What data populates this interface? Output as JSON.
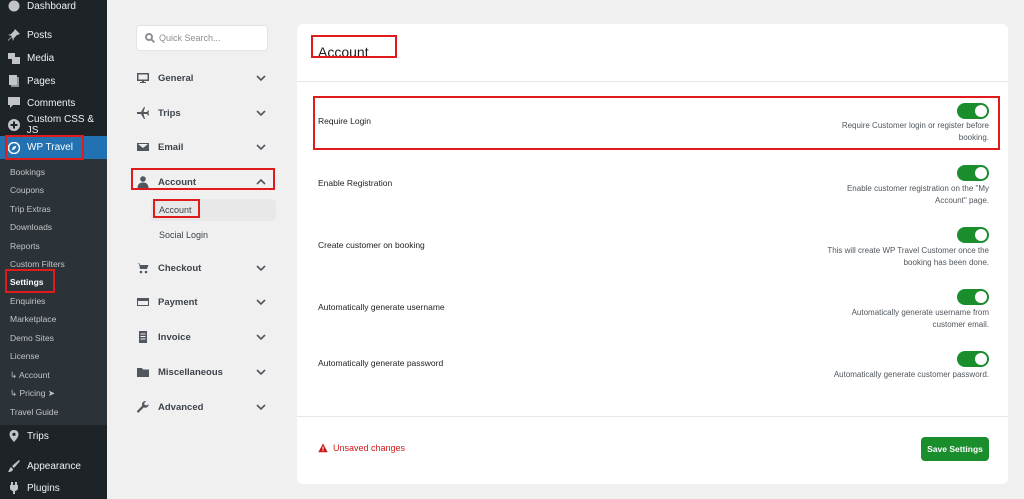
{
  "wp_sidebar": {
    "items": [
      {
        "label": "Dashboard",
        "icon": "dashboard-icon"
      },
      {
        "label": "Posts",
        "icon": "pin-icon"
      },
      {
        "label": "Media",
        "icon": "media-icon"
      },
      {
        "label": "Pages",
        "icon": "pages-icon"
      },
      {
        "label": "Comments",
        "icon": "comment-icon"
      },
      {
        "label": "Custom CSS & JS",
        "icon": "plus-circle-icon"
      },
      {
        "label": "WP Travel",
        "icon": "compass-icon"
      },
      {
        "label": "Trips",
        "icon": "location-pin-icon"
      },
      {
        "label": "Appearance",
        "icon": "paintbrush-icon"
      },
      {
        "label": "Plugins",
        "icon": "plug-icon"
      }
    ],
    "submenu": [
      "Bookings",
      "Coupons",
      "Trip Extras",
      "Downloads",
      "Reports",
      "Custom Filters",
      "Settings",
      "Enquiries",
      "Marketplace",
      "Demo Sites",
      "License",
      "↳ Account",
      "↳ Pricing ➤",
      "Travel Guide"
    ]
  },
  "settings_nav": {
    "search_placeholder": "Quick Search...",
    "sections": [
      {
        "label": "General",
        "icon": "monitor-icon"
      },
      {
        "label": "Trips",
        "icon": "plane-icon"
      },
      {
        "label": "Email",
        "icon": "envelope-icon"
      },
      {
        "label": "Account",
        "icon": "user-icon"
      },
      {
        "label": "Checkout",
        "icon": "cart-icon"
      },
      {
        "label": "Payment",
        "icon": "credit-card-icon"
      },
      {
        "label": "Invoice",
        "icon": "document-icon"
      },
      {
        "label": "Miscellaneous",
        "icon": "folder-icon"
      },
      {
        "label": "Advanced",
        "icon": "wrench-icon"
      }
    ],
    "account_sub": [
      "Account",
      "Social Login"
    ]
  },
  "panel": {
    "title": "Account",
    "rows": [
      {
        "label": "Require Login",
        "desc": "Require Customer login or register before booking.",
        "on": true
      },
      {
        "label": "Enable Registration",
        "desc": "Enable customer registration on the \"My Account\" page.",
        "on": true
      },
      {
        "label": "Create customer on booking",
        "desc": "This will create WP Travel Customer once the booking has been done.",
        "on": true
      },
      {
        "label": "Automatically generate username",
        "desc": "Automatically generate username from customer email.",
        "on": true
      },
      {
        "label": "Automatically generate password",
        "desc": "Automatically generate customer password.",
        "on": true
      }
    ],
    "unsaved": "Unsaved changes",
    "save_label": "Save Settings"
  },
  "colors": {
    "accent_green": "#1a8d2d",
    "wp_blue": "#2271b1",
    "highlight_red": "#e01b1b"
  }
}
